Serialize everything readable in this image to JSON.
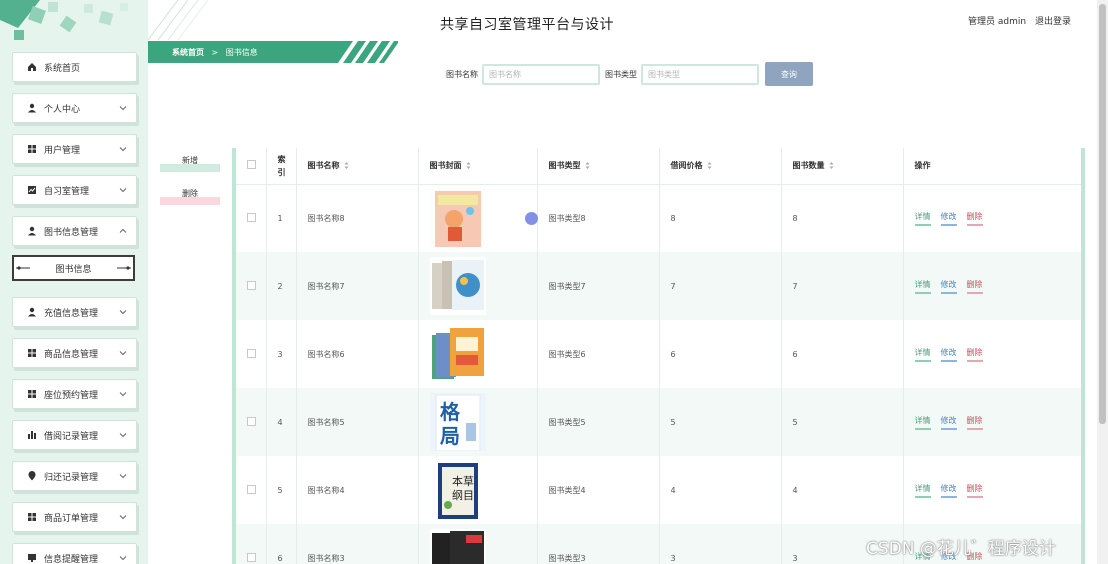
{
  "app": {
    "title": "共享自习室管理平台与设计"
  },
  "user": {
    "role_label": "管理员 admin",
    "logout_label": "退出登录"
  },
  "breadcrumb": {
    "home": "系统首页",
    "separator": ">",
    "current": "图书信息"
  },
  "sidebar": {
    "items": [
      {
        "label": "系统首页",
        "icon": "home-icon",
        "has_chevron": false
      },
      {
        "label": "个人中心",
        "icon": "user-icon",
        "has_chevron": true
      },
      {
        "label": "用户管理",
        "icon": "grid-icon",
        "has_chevron": true
      },
      {
        "label": "自习室管理",
        "icon": "chart-icon",
        "has_chevron": true
      },
      {
        "label": "图书信息管理",
        "icon": "user-icon",
        "has_chevron": true,
        "expanded": true
      },
      {
        "label": "充值信息管理",
        "icon": "user-icon",
        "has_chevron": true
      },
      {
        "label": "商品信息管理",
        "icon": "grid-icon",
        "has_chevron": true
      },
      {
        "label": "座位预约管理",
        "icon": "grid-icon",
        "has_chevron": true
      },
      {
        "label": "借阅记录管理",
        "icon": "bar-chart-icon",
        "has_chevron": true
      },
      {
        "label": "归还记录管理",
        "icon": "location-icon",
        "has_chevron": true
      },
      {
        "label": "商品订单管理",
        "icon": "grid-icon",
        "has_chevron": true
      },
      {
        "label": "信息提醒管理",
        "icon": "monitor-icon",
        "has_chevron": true
      }
    ],
    "active_subitem": "图书信息"
  },
  "search": {
    "name_label": "图书名称",
    "name_placeholder": "图书名称",
    "type_label": "图书类型",
    "type_placeholder": "图书类型",
    "button_label": "查询"
  },
  "actions": {
    "add_label": "新增",
    "delete_label": "删除"
  },
  "table": {
    "columns": [
      "索引",
      "图书名称",
      "图书封面",
      "图书类型",
      "借阅价格",
      "图书数量",
      "操作"
    ],
    "op_labels": {
      "detail": "详情",
      "edit": "修改",
      "delete": "删除"
    },
    "rows": [
      {
        "index": "1",
        "name": "图书名称8",
        "type": "图书类型8",
        "price": "8",
        "qty": "8"
      },
      {
        "index": "2",
        "name": "图书名称7",
        "type": "图书类型7",
        "price": "7",
        "qty": "7"
      },
      {
        "index": "3",
        "name": "图书名称6",
        "type": "图书类型6",
        "price": "6",
        "qty": "6"
      },
      {
        "index": "4",
        "name": "图书名称5",
        "type": "图书类型5",
        "price": "5",
        "qty": "5"
      },
      {
        "index": "5",
        "name": "图书名称4",
        "type": "图书类型4",
        "price": "4",
        "qty": "4"
      },
      {
        "index": "6",
        "name": "图书名称3",
        "type": "图书类型3",
        "price": "3",
        "qty": "3"
      }
    ]
  },
  "watermark": "CSDN @花儿゛程序设计",
  "colors": {
    "accent": "#3aa57f",
    "sidebar_bg": "#e6f4ee",
    "search_button": "#8fa4bf",
    "detail": "#4c9a7c",
    "edit": "#3f83c3",
    "delete": "#cc4a5a"
  }
}
